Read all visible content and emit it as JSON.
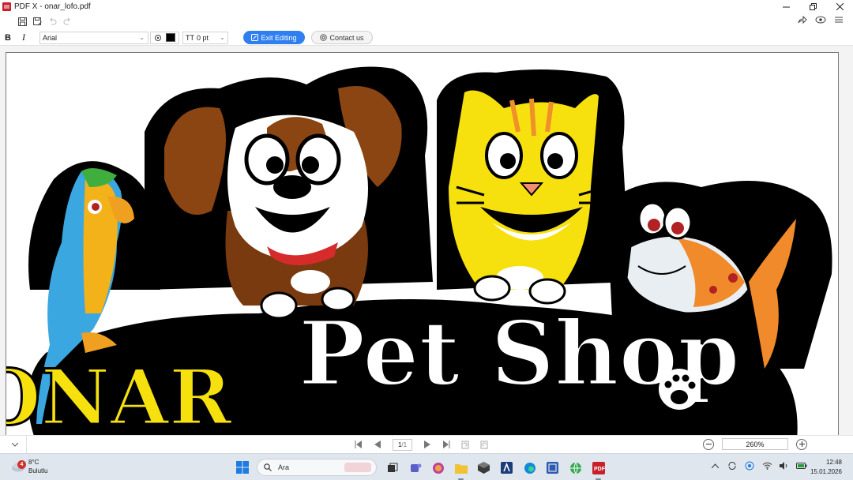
{
  "window": {
    "title": "PDF X - onar_lofo.pdf"
  },
  "toolbar": {
    "bold_label": "B",
    "italic_label": "I",
    "font_value": "Arial",
    "size_value": "0 pt",
    "size_prefix": "TT",
    "exit_editing_label": "Exit Editing",
    "contact_label": "Contact us",
    "text_color": "#000000"
  },
  "document": {
    "logo_text_left": "ONAR",
    "logo_text_main": "Pet Shop"
  },
  "statusbar": {
    "current_page": "1",
    "total_pages": "/1",
    "zoom_value": "260%"
  },
  "taskbar": {
    "weather_temp": "8°C",
    "weather_desc": "Bulutlu",
    "weather_badge": "4",
    "search_placeholder": "Ara",
    "time": "12:48",
    "date": "15.01.2026"
  },
  "colors": {
    "accent": "#2f7ff0",
    "app_brand": "#c8202a"
  }
}
